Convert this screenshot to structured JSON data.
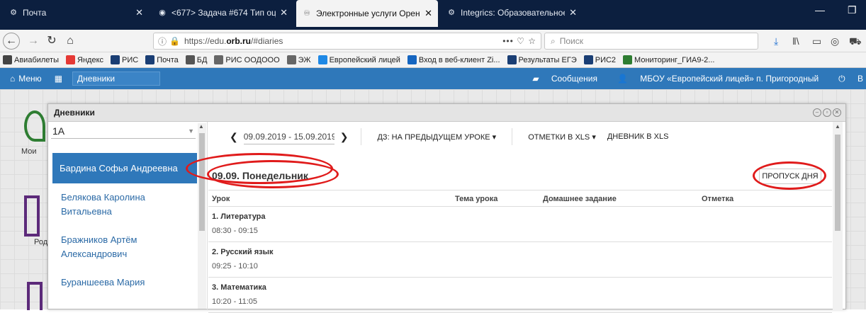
{
  "browser": {
    "tabs": [
      {
        "label": "Почта",
        "icon": "gear-icon"
      },
      {
        "label": "<677> Задача #674 Тип оцен",
        "icon": "redmine-icon"
      },
      {
        "label": "Электронные услуги Оренбур",
        "icon": "edu-icon"
      },
      {
        "label": "Integrics: Образовательное уч",
        "icon": "gear-icon"
      }
    ],
    "url_prefix": "https://edu.",
    "url_host": "orb.ru",
    "url_path": "/#diaries",
    "search_placeholder": "Поиск",
    "bookmarks": [
      {
        "label": "Авиабилеты",
        "color": "#444444"
      },
      {
        "label": "Яндекс",
        "color": "#e53935"
      },
      {
        "label": "РИС",
        "color": "#1a3e74"
      },
      {
        "label": "Почта",
        "color": "#1a3e74"
      },
      {
        "label": "БД",
        "color": "#555555"
      },
      {
        "label": "РИС ООДООО",
        "color": "#666666"
      },
      {
        "label": "ЭЖ",
        "color": "#666666"
      },
      {
        "label": "Европейский лицей",
        "color": "#1e88e5"
      },
      {
        "label": "Вход в веб-клиент Zi...",
        "color": "#1565c0"
      },
      {
        "label": "Результаты ЕГЭ",
        "color": "#1a3e74"
      },
      {
        "label": "РИС2",
        "color": "#1a3e74"
      },
      {
        "label": "Мониторинг_ГИА9-2...",
        "color": "#2e7d32"
      }
    ]
  },
  "app": {
    "menu_label": "Меню",
    "breadcrumb": "Дневники",
    "messages_label": "Сообщения",
    "school_label": "МБОУ «Европейский лицей» п. Пригородный",
    "logout_label": "В",
    "accent": "#2f78ba"
  },
  "desktop": {
    "icon_labels": [
      "Мои",
      "Род"
    ]
  },
  "window": {
    "title": "Дневники",
    "class_value": "1А",
    "students": [
      "Бардина Софья Андреевна",
      "Белякова Каролина Витальевна",
      "Бражников Артём Александрович",
      "Бураншеева Мария"
    ],
    "date_range": "09.09.2019 - 15.09.2019",
    "toolbar": {
      "homework_label": "ДЗ: НА ПРЕДЫДУЩЕМ УРОКЕ",
      "marks_xls_label": "ОТМЕТКИ В XLS",
      "diary_xls_label": "ДНЕВНИК В XLS"
    },
    "day_title": "09.09. Понедельник",
    "skip_day_label": "ПРОПУСК ДНЯ",
    "columns": [
      "Урок",
      "Тема урока",
      "Домашнее задание",
      "Отметка"
    ],
    "lessons": [
      {
        "name": "1. Литература",
        "time": "08:30 - 09:15"
      },
      {
        "name": "2. Русский язык",
        "time": "09:25 - 10:10"
      },
      {
        "name": "3. Математика",
        "time": "10:20 - 11:05"
      }
    ],
    "highlight_color": "#e01b1b"
  }
}
